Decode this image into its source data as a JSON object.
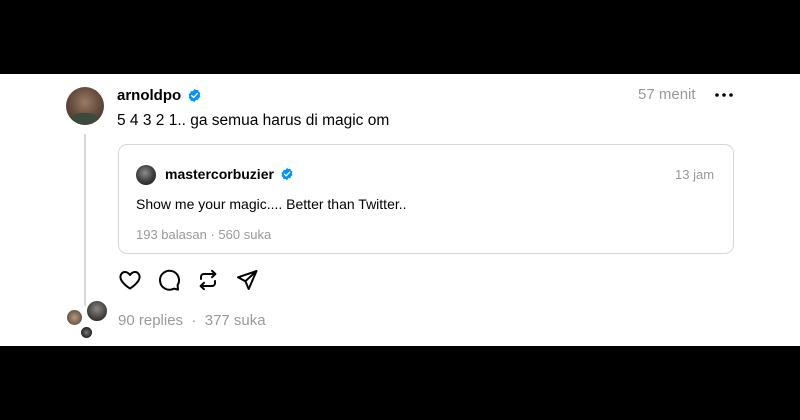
{
  "post": {
    "username": "arnoldpo",
    "time": "57 menit",
    "text": "5 4 3 2 1.. ga semua harus di magic om"
  },
  "quoted_post": {
    "username": "mastercorbuzier",
    "time": "13 jam",
    "text": "Show me your magic.... Better than Twitter..",
    "replies": "193 balasan",
    "separator": "·",
    "likes": "560 suka"
  },
  "footer": {
    "replies": "90 replies",
    "separator": "·",
    "likes": "377 suka"
  },
  "icons": {
    "verified": "verified-badge-icon",
    "more": "more-options-icon",
    "like": "heart-icon",
    "reply": "comment-icon",
    "repost": "repost-icon",
    "share": "send-icon"
  },
  "colors": {
    "verified": "#0095f6",
    "muted": "#999999",
    "border": "#d6d6d6"
  }
}
